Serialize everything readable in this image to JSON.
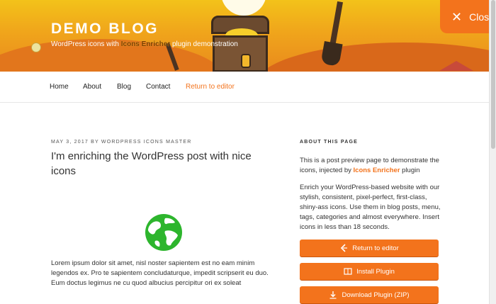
{
  "header": {
    "site_title": "DEMO BLOG",
    "description_before": "WordPress icons with ",
    "description_highlight": "Icons Enricher",
    "description_after": " plugin demonstration"
  },
  "close_button": {
    "label": "Close",
    "icon": "close-icon"
  },
  "nav": {
    "items": [
      {
        "label": "Home"
      },
      {
        "label": "About"
      },
      {
        "label": "Blog"
      },
      {
        "label": "Contact"
      },
      {
        "label": "Return to editor"
      }
    ]
  },
  "post": {
    "meta": "MAY 3, 2017 BY WORDPRESS ICONS MASTER",
    "title": "I'm enriching the WordPress post with nice icons",
    "image_icon": "globe-icon",
    "body": "Lorem ipsum dolor sit amet, nisl noster sapientem est no eam minim legendos ex. Pro te sapientem concludaturque, impedit scripserit eu duo. Eum doctus legimus ne cu quod albucius percipitur ori ex soleat"
  },
  "sidebar": {
    "heading": "ABOUT THIS PAGE",
    "text1_before": "This is a post preview page to demonstrate the icons, injected by ",
    "text1_highlight": "Icons Enricher",
    "text1_after": " plugin",
    "text2": "Enrich your WordPress-based website with our stylish, consistent, pixel-perfect, first-class, shiny-ass icons. Use them in blog posts, menu, tags, categories and almost everywhere. Insert icons in less than 18 seconds.",
    "buttons": [
      {
        "label": "Return to editor",
        "icon": "pen-icon"
      },
      {
        "label": "Install Plugin",
        "icon": "book-icon"
      },
      {
        "label": "Download Plugin (ZIP)",
        "icon": "download-icon"
      }
    ]
  },
  "colors": {
    "accent": "#f3731c",
    "header_yellow": "#f3c21a",
    "globe_green": "#2db52d"
  }
}
